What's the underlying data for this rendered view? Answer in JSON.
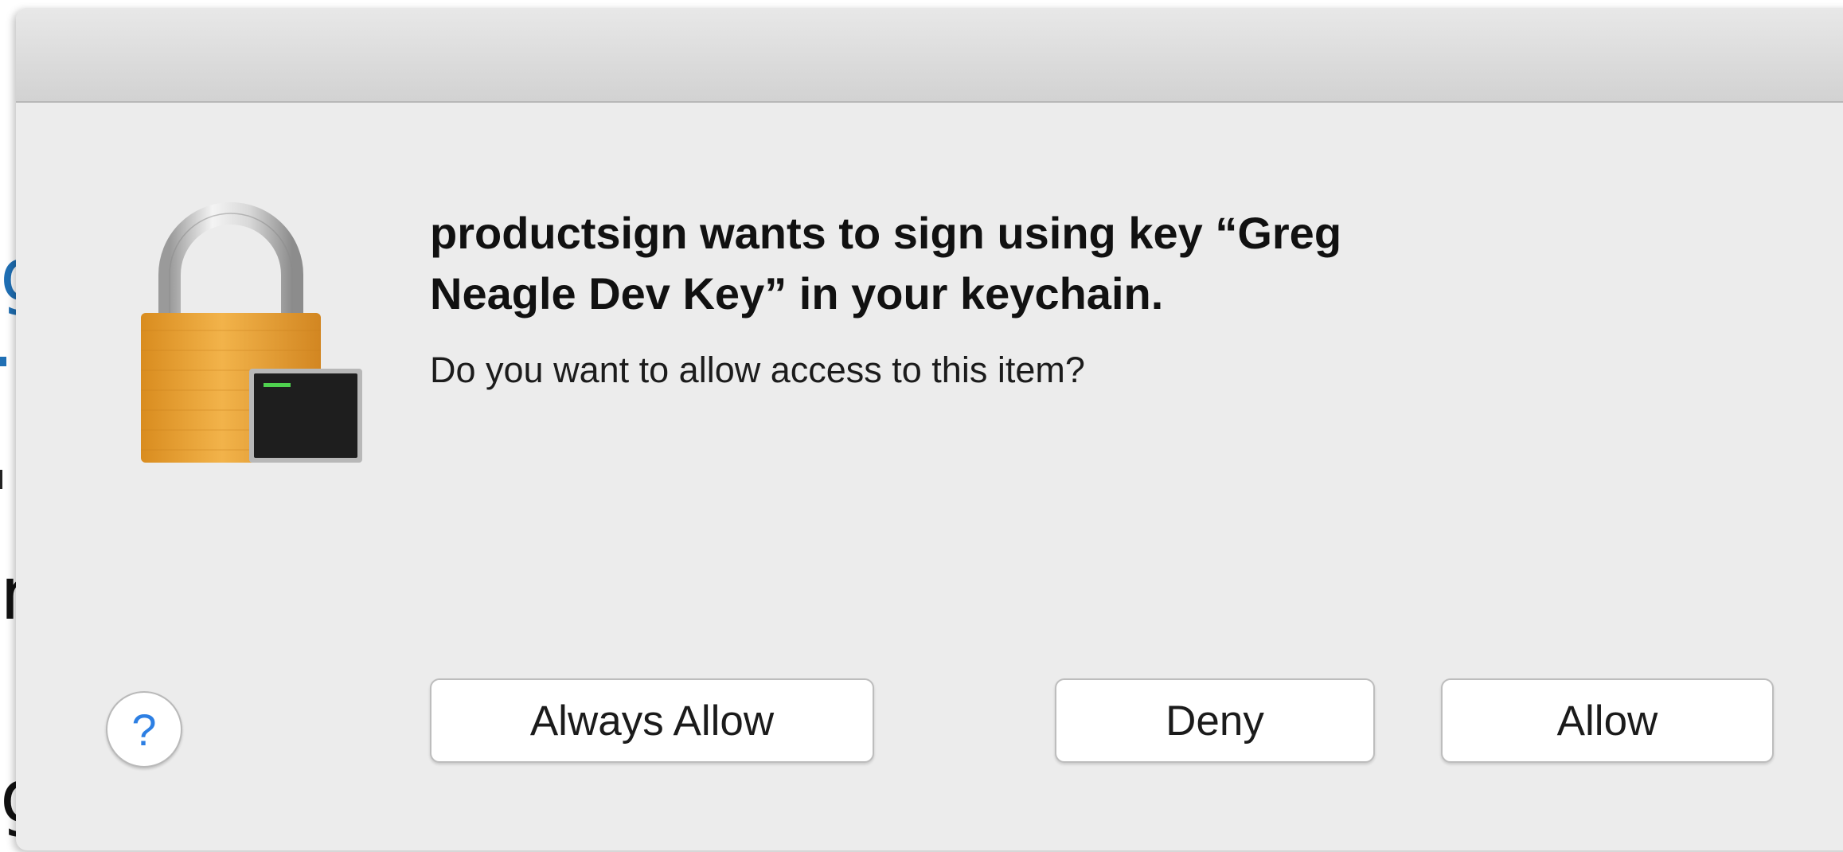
{
  "background": {
    "fragments": [
      "g",
      "n",
      "g"
    ]
  },
  "dialog": {
    "title": "productsign wants to sign using key “Greg Neagle Dev Key” in your keychain.",
    "title_line1": "productsign wants to sign using key “Greg",
    "title_line2": "Neagle Dev Key” in your keychain.",
    "subtitle": "Do you want to allow access to this item?",
    "icon": "keychain-lock-icon",
    "help_label": "?",
    "buttons": {
      "always_allow": "Always Allow",
      "deny": "Deny",
      "allow": "Allow"
    }
  },
  "colors": {
    "dialog_bg": "#ececec",
    "help_accent": "#2d7fe3",
    "lock_gold": "#e8a33a",
    "terminal_green": "#4fd14f"
  }
}
